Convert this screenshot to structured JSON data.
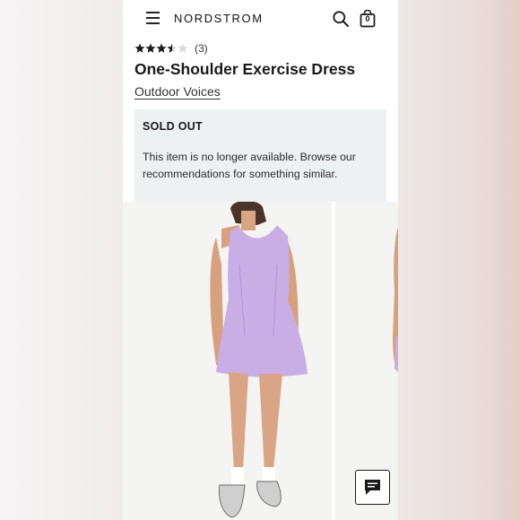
{
  "header": {
    "logo_text": "NORDSTROM",
    "menu_icon": "hamburger-menu-icon",
    "search_icon": "search-icon",
    "bag_icon": "shopping-bag-icon",
    "bag_count": "0"
  },
  "product": {
    "rating_stars": 3.5,
    "rating_max": 5,
    "review_count": "(3)",
    "title": "One-Shoulder Exercise Dress",
    "brand": "Outdoor Voices"
  },
  "availability": {
    "status": "SOLD OUT",
    "message": "This item is no longer available. Browse our recommendations for something similar."
  },
  "gallery": {
    "dress_color": "#c9aee6",
    "images": [
      "product-photo-main",
      "product-photo-next"
    ]
  },
  "chat": {
    "icon": "chat-icon"
  },
  "colors": {
    "text": "#1a1a1a",
    "notice_bg": "#edf1f2",
    "star": "#1a1a1a"
  }
}
